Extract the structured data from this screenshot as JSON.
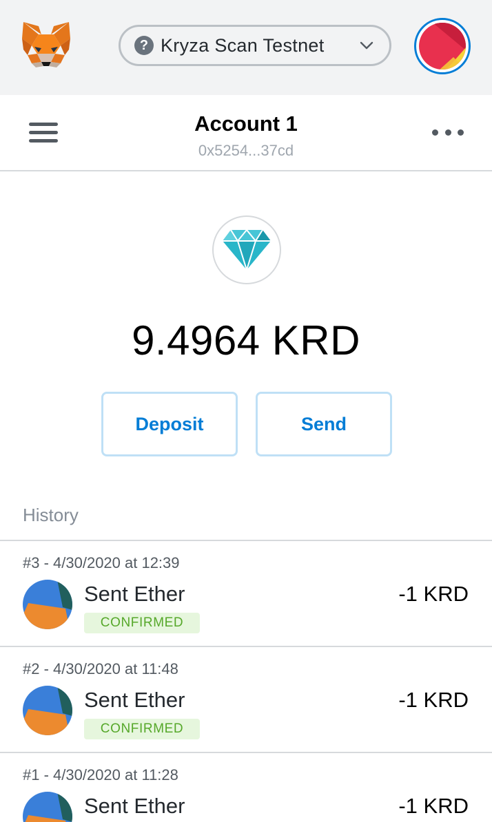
{
  "topbar": {
    "logo_icon": "metamask-fox-icon",
    "network": {
      "icon": "question-circle-icon",
      "name": "Kryza Scan Testnet",
      "chevron": "chevron-down-icon"
    },
    "account_avatar": "identicon-avatar"
  },
  "account": {
    "menu_icon": "hamburger-menu-icon",
    "name": "Account 1",
    "address": "0x5254...37cd",
    "more_icon": "more-dots-icon"
  },
  "wallet": {
    "token_icon": "diamond-icon",
    "balance": "9.4964 KRD",
    "deposit_label": "Deposit",
    "send_label": "Send"
  },
  "history": {
    "title": "History",
    "transactions": [
      {
        "date": "#3 - 4/30/2020 at 12:39",
        "title": "Sent Ether",
        "status": "CONFIRMED",
        "amount": "-1 KRD"
      },
      {
        "date": "#2 - 4/30/2020 at 11:48",
        "title": "Sent Ether",
        "status": "CONFIRMED",
        "amount": "-1 KRD"
      },
      {
        "date": "#1 - 4/30/2020 at 11:28",
        "title": "Sent Ether",
        "status": "",
        "amount": "-1 KRD"
      }
    ]
  },
  "colors": {
    "accent": "#037dd6",
    "confirmed_bg": "#e6f6dd",
    "confirmed_text": "#56a82a",
    "token": "#29b6c9"
  }
}
